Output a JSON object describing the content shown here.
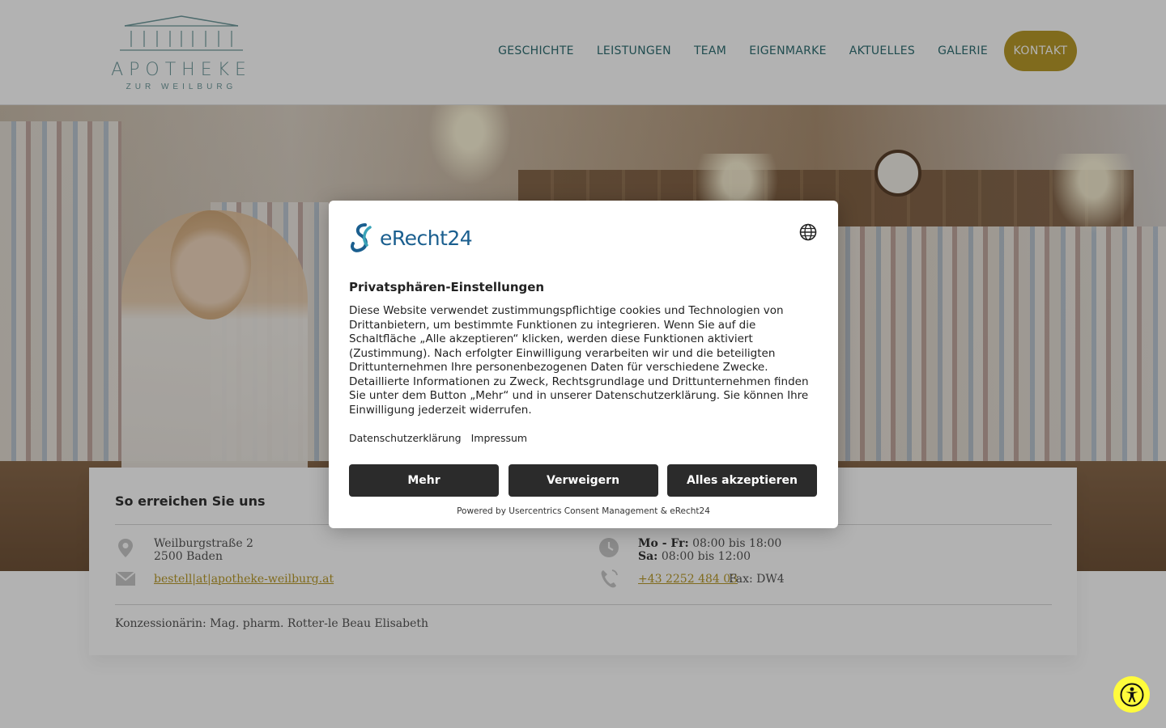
{
  "logo": {
    "name": "APOTHEKE",
    "subtitle": "ZUR WEILBURG"
  },
  "nav": {
    "items": [
      "GESCHICHTE",
      "LEISTUNGEN",
      "TEAM",
      "EIGENMARKE",
      "AKTUELLES",
      "GALERIE"
    ],
    "cta": "KONTAKT"
  },
  "contact": {
    "title": "So erreichen Sie uns",
    "street": "Weilburgstraße 2",
    "city": "2500 Baden",
    "email": "bestell|at|apotheke-weilburg.at",
    "hours_weekday_label": "Mo - Fr:",
    "hours_weekday": "08:00 bis 18:00",
    "hours_sat_label": "Sa:",
    "hours_sat": "08:00 bis 12:00",
    "phone": "+43 2252 484 03",
    "fax": "Fax: DW4",
    "license": "Konzessionärin: Mag. pharm. Rotter-le Beau Elisabeth"
  },
  "consent": {
    "brand": "eRecht24",
    "title": "Privatsphären-Einstellungen",
    "body": "Diese Website verwendet zustimmungspflichtige cookies und Technologien von Drittanbietern, um bestimmte Funktionen zu integrieren. Wenn Sie auf die Schaltfläche „Alle akzeptieren“ klicken, werden diese Funktionen aktiviert (Zustimmung). Nach erfolgter Einwilligung verarbeiten wir und die beteiligten Drittunternehmen Ihre personenbezogenen Daten für verschiedene Zwecke. Detaillierte Informationen zu Zweck, Rechtsgrundlage und Drittunternehmen finden Sie unter dem Button „Mehr“ und in unserer Datenschutzerklärung. Sie können Ihre Einwilligung jederzeit widerrufen.",
    "link_privacy": "Datenschutzerklärung",
    "link_imprint": "Impressum",
    "btn_more": "Mehr",
    "btn_deny": "Verweigern",
    "btn_accept": "Alles akzeptieren",
    "powered_by": "Powered by Usercentrics Consent Management & eRecht24"
  },
  "colors": {
    "brand_teal": "#2f6e72",
    "gold": "#b89a2a",
    "dialog_button": "#2b2b2b",
    "accessibility": "#fffb3c"
  },
  "icons": [
    "location-pin-icon",
    "envelope-icon",
    "clock-icon",
    "phone-icon",
    "globe-icon",
    "accessibility-icon"
  ]
}
